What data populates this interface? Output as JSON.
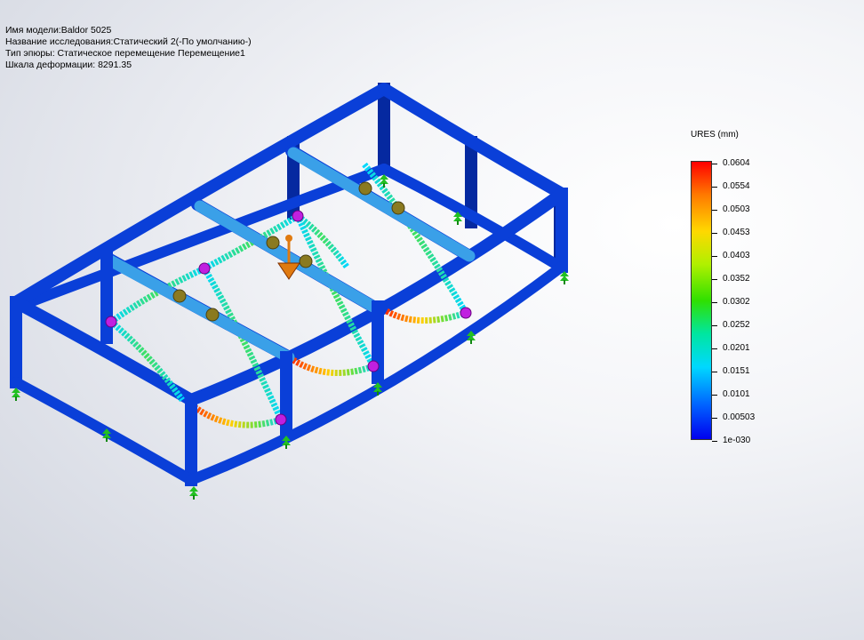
{
  "study_info": {
    "model_name": "Имя модели:Baldor 5025",
    "study_name": "Название исследования:Статический 2(-По умолчанию-)",
    "plot_type": "Тип эпюры: Статическое перемещение Перемещение1",
    "deformation_scale": "Шкала деформации: 8291.35"
  },
  "legend": {
    "title": "URES (mm)",
    "values": [
      "0.0604",
      "0.0554",
      "0.0503",
      "0.0453",
      "0.0403",
      "0.0352",
      "0.0302",
      "0.0252",
      "0.0201",
      "0.0151",
      "0.0101",
      "0.00503",
      "1e-030"
    ]
  },
  "colors": {
    "frame": "#0a3fd8",
    "frame_dark": "#0529a0",
    "crossbar": "#3aa0e8",
    "fixture": "#22c022",
    "node_marker": "#c020e0",
    "load_marker": "#e07a10",
    "connector_ball": "#8a7a20"
  }
}
